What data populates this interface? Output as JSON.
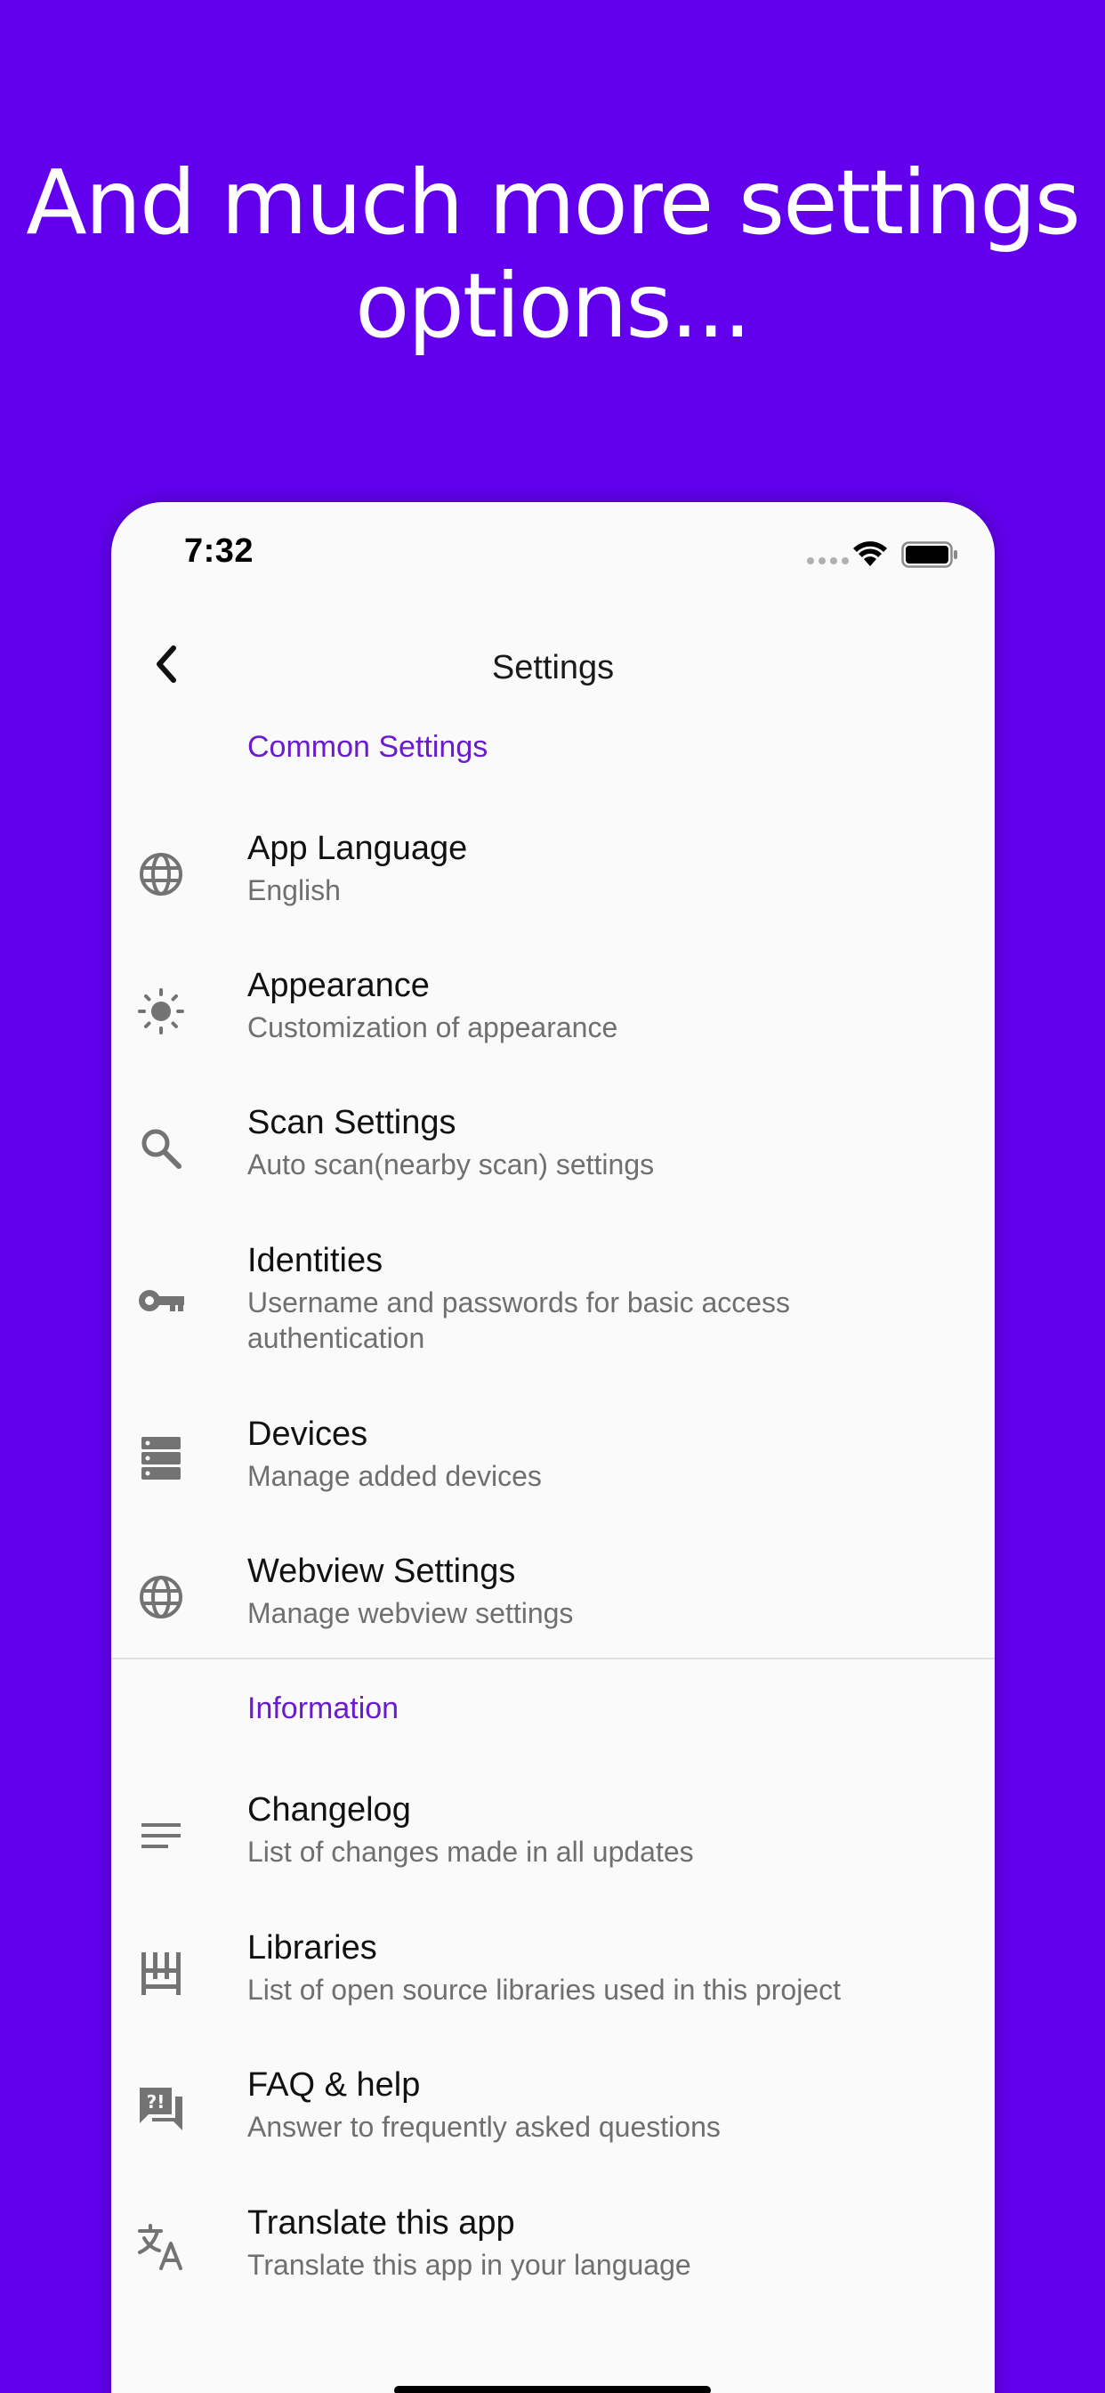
{
  "headline": {
    "line1": "And much more settings",
    "line2": "options..."
  },
  "status_bar": {
    "time": "7:32",
    "icons": [
      "signal-icon",
      "wifi-icon",
      "battery-icon"
    ]
  },
  "app_bar": {
    "title": "Settings",
    "back_icon": "chevron-left-icon"
  },
  "sections": [
    {
      "header": "Common Settings",
      "items": [
        {
          "icon": "globe-icon",
          "title": "App Language",
          "subtitle": "English"
        },
        {
          "icon": "sun-icon",
          "title": "Appearance",
          "subtitle": "Customization of appearance"
        },
        {
          "icon": "search-icon",
          "title": "Scan Settings",
          "subtitle": "Auto scan(nearby scan) settings"
        },
        {
          "icon": "key-icon",
          "title": "Identities",
          "subtitle": "Username and passwords for basic access authentication"
        },
        {
          "icon": "server-icon",
          "title": "Devices",
          "subtitle": "Manage added devices"
        },
        {
          "icon": "globe-icon",
          "title": "Webview Settings",
          "subtitle": "Manage webview settings"
        }
      ]
    },
    {
      "header": "Information",
      "items": [
        {
          "icon": "notes-icon",
          "title": "Changelog",
          "subtitle": "List of changes made in all updates"
        },
        {
          "icon": "library-icon",
          "title": "Libraries",
          "subtitle": "List of open source libraries used in this project"
        },
        {
          "icon": "faq-icon",
          "title": "FAQ & help",
          "subtitle": "Answer to frequently asked questions"
        },
        {
          "icon": "translate-icon",
          "title": "Translate this app",
          "subtitle": "Translate this app in your language"
        }
      ]
    }
  ],
  "colors": {
    "background": "#6200ee",
    "accent": "#6a1bcb",
    "surface": "#fafafa",
    "icon": "#737373"
  }
}
